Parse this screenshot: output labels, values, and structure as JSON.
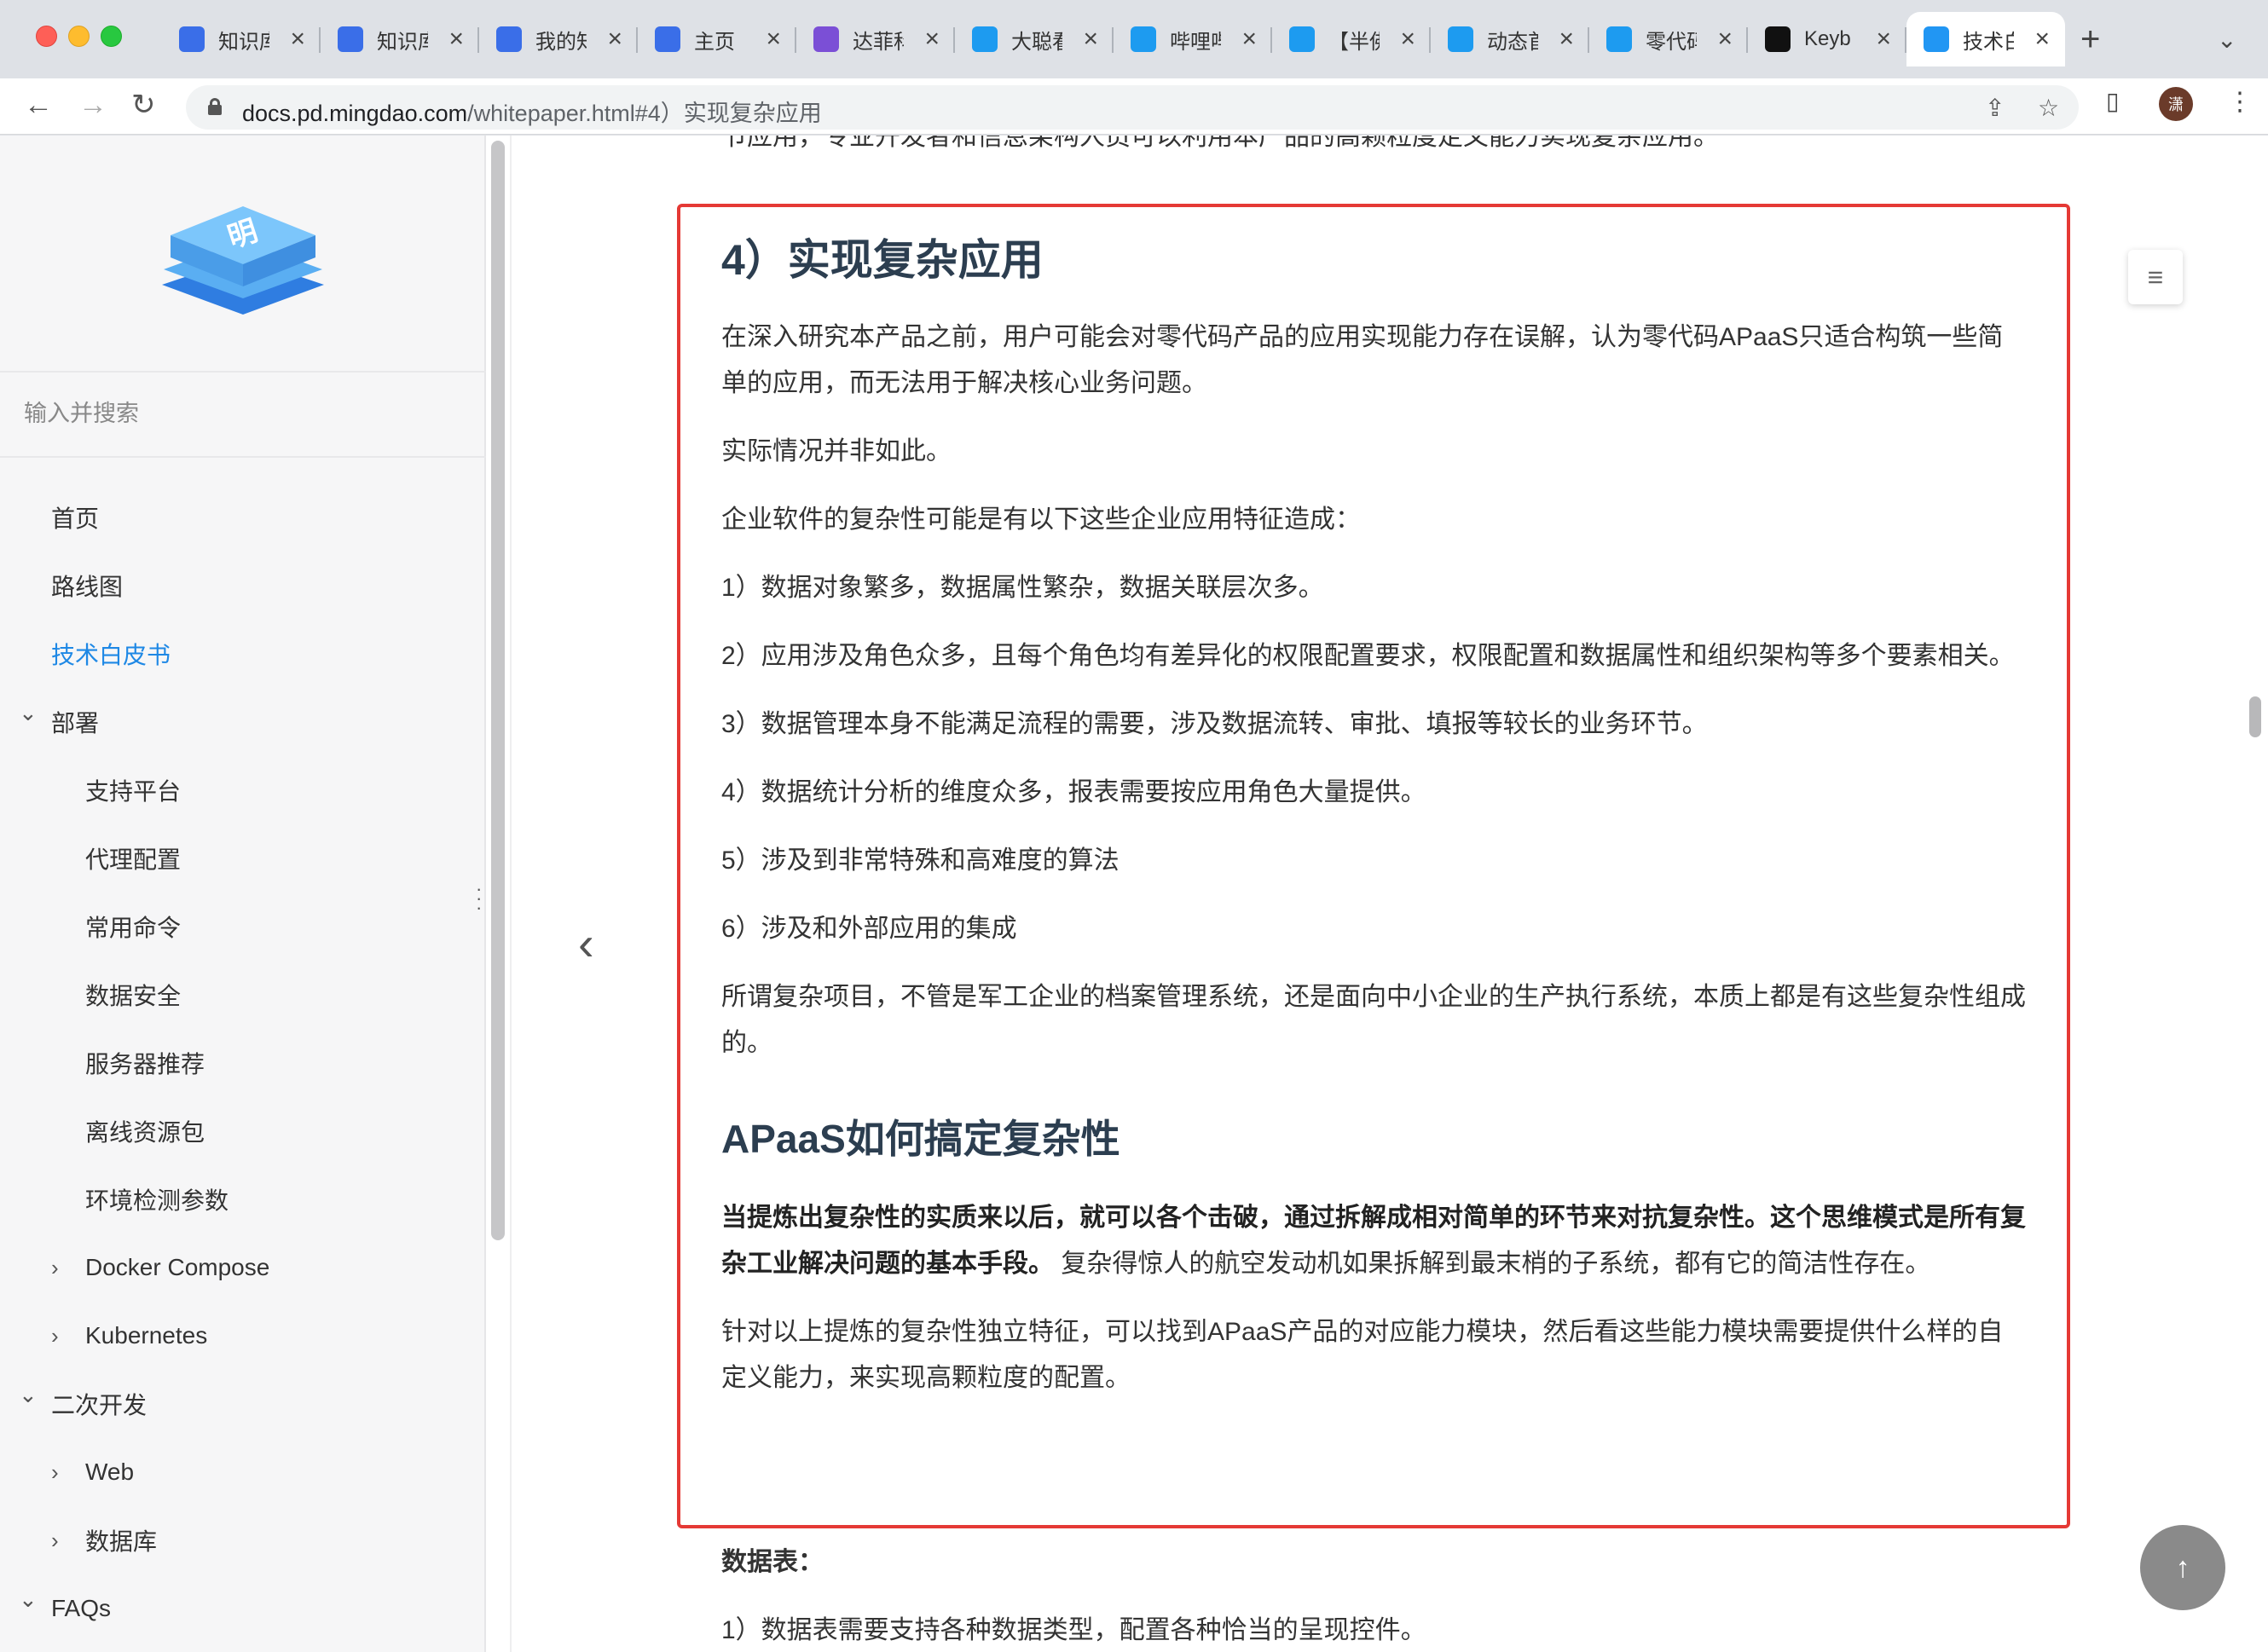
{
  "browser": {
    "tabs": [
      {
        "title": "知识库",
        "icon": "yuque-icon",
        "color": "#3a6ee8"
      },
      {
        "title": "知识库",
        "icon": "yuque-icon",
        "color": "#3a6ee8"
      },
      {
        "title": "我的知",
        "icon": "yuque-icon",
        "color": "#3a6ee8"
      },
      {
        "title": "主页",
        "icon": "yuque-icon",
        "color": "#3a6ee8"
      },
      {
        "title": "达菲科",
        "icon": "list-app-icon",
        "color": "#7b4fd6"
      },
      {
        "title": "大聪看",
        "icon": "bilibili-icon",
        "color": "#1d9bf0"
      },
      {
        "title": "哔哩哔",
        "icon": "bilibili-icon",
        "color": "#1d9bf0"
      },
      {
        "title": "【半佛",
        "icon": "bilibili-icon",
        "color": "#1d9bf0"
      },
      {
        "title": "动态首",
        "icon": "bilibili-icon",
        "color": "#1d9bf0"
      },
      {
        "title": "零代码",
        "icon": "bilibili-icon",
        "color": "#1d9bf0"
      },
      {
        "title": "Keyb",
        "icon": "notion-icon",
        "color": "#111111"
      },
      {
        "title": "技术白",
        "icon": "cube-icon",
        "color": "#2196f3",
        "active": true
      }
    ],
    "url_host": "docs.pd.mingdao.com",
    "url_path": "/whitepaper.html#4）实现复杂应用",
    "avatar_text": "潇"
  },
  "sidebar": {
    "search_placeholder": "输入并搜索",
    "items": [
      {
        "label": "首页",
        "level": 0,
        "arrow": ""
      },
      {
        "label": "路线图",
        "level": 0,
        "arrow": ""
      },
      {
        "label": "技术白皮书",
        "level": 0,
        "arrow": "",
        "active": true
      },
      {
        "label": "部署",
        "level": 0,
        "arrow": "down"
      },
      {
        "label": "支持平台",
        "level": 1,
        "arrow": ""
      },
      {
        "label": "代理配置",
        "level": 1,
        "arrow": ""
      },
      {
        "label": "常用命令",
        "level": 1,
        "arrow": ""
      },
      {
        "label": "数据安全",
        "level": 1,
        "arrow": ""
      },
      {
        "label": "服务器推荐",
        "level": 1,
        "arrow": ""
      },
      {
        "label": "离线资源包",
        "level": 1,
        "arrow": ""
      },
      {
        "label": "环境检测参数",
        "level": 1,
        "arrow": ""
      },
      {
        "label": "Docker Compose",
        "level": 1,
        "arrow": "right"
      },
      {
        "label": "Kubernetes",
        "level": 1,
        "arrow": "right"
      },
      {
        "label": "二次开发",
        "level": 0,
        "arrow": "down"
      },
      {
        "label": "Web",
        "level": 1,
        "arrow": "right"
      },
      {
        "label": "数据库",
        "level": 1,
        "arrow": "right"
      },
      {
        "label": "FAQs",
        "level": 0,
        "arrow": "down"
      }
    ]
  },
  "article": {
    "top_cut_text": "节应用，专业开发者和信息架构人员可以利用本产品的高颗粒度定义能力实现复杂应用。",
    "heading": "4）实现复杂应用",
    "paragraphs": [
      "在深入研究本产品之前，用户可能会对零代码产品的应用实现能力存在误解，认为零代码APaaS只适合构筑一些简单的应用，而无法用于解决核心业务问题。",
      "实际情况并非如此。",
      "企业软件的复杂性可能是有以下这些企业应用特征造成：",
      "1）数据对象繁多，数据属性繁杂，数据关联层次多。",
      "2）应用涉及角色众多，且每个角色均有差异化的权限配置要求，权限配置和数据属性和组织架构等多个要素相关。",
      "3）数据管理本身不能满足流程的需要，涉及数据流转、审批、填报等较长的业务环节。",
      "4）数据统计分析的维度众多，报表需要按应用角色大量提供。",
      "5）涉及到非常特殊和高难度的算法",
      "6）涉及和外部应用的集成",
      "所谓复杂项目，不管是军工企业的档案管理系统，还是面向中小企业的生产执行系统，本质上都是有这些复杂性组成的。"
    ],
    "subheading": "APaaS如何搞定复杂性",
    "bold_text": "当提炼出复杂性的实质来以后，就可以各个击破，通过拆解成相对简单的环节来对抗复杂性。这个思维模式是所有复杂工业解决问题的基本手段。",
    "after_bold_text": " 复杂得惊人的航空发动机如果拆解到最末梢的子系统，都有它的简洁性存在。",
    "closing_paragraph": "针对以上提炼的复杂性独立特征，可以找到APaaS产品的对应能力模块，然后看这些能力模块需要提供什么样的自定义能力，来实现高颗粒度的配置。",
    "after_box_label": "数据表：",
    "after_box_item": "1）数据表需要支持各种数据类型，配置各种恰当的呈现控件。"
  },
  "colors": {
    "highlight_border": "#e53935",
    "active_link": "#1e88e5"
  }
}
